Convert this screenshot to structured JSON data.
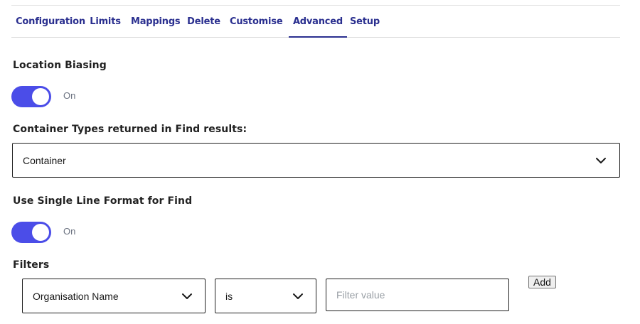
{
  "tabs": [
    {
      "label": "Configuration"
    },
    {
      "label": "Limits"
    },
    {
      "label": "Mappings"
    },
    {
      "label": "Delete"
    },
    {
      "label": "Customise"
    },
    {
      "label": "Advanced",
      "active": true
    },
    {
      "label": "Setup"
    }
  ],
  "location_biasing": {
    "label": "Location Biasing",
    "state": "On"
  },
  "container_types": {
    "label": "Container Types returned in Find results:",
    "selected": "Container"
  },
  "single_line_format": {
    "label": "Use Single Line Format for Find",
    "state": "On"
  },
  "filters": {
    "label": "Filters",
    "field_selected": "Organisation Name",
    "operator_selected": "is",
    "value_placeholder": "Filter value",
    "add_label": "Add"
  },
  "colors": {
    "accent": "#4b4de8",
    "tab_text": "#2a2f8f"
  },
  "icons": {
    "select_arrow": "chevron-down-icon"
  }
}
